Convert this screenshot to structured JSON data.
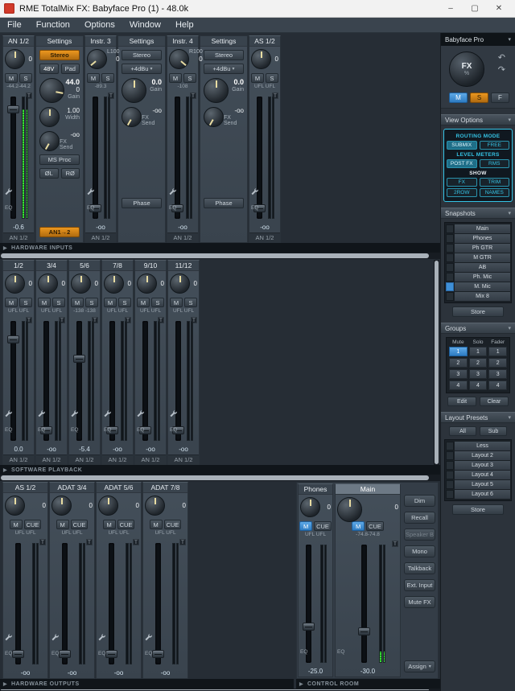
{
  "window": {
    "title": "RME TotalMix FX: Babyface Pro (1) - 48.0k",
    "minimize": "–",
    "maximize": "▢",
    "close": "✕"
  },
  "menu": {
    "items": [
      "File",
      "Function",
      "Options",
      "Window",
      "Help"
    ]
  },
  "common": {
    "mute": "M",
    "solo": "S",
    "cue": "CUE",
    "eq": "EQ",
    "trim": "T",
    "store": "Store"
  },
  "icons": {
    "chevron_down": "▾",
    "triangle_right": "▶",
    "undo": "↶",
    "redo": "↷"
  },
  "colors": {
    "accent_cyan": "#35c3e5",
    "accent_blue": "#3f8fd6",
    "accent_orange": "#c97c1f",
    "meter_green": "#38e038"
  },
  "hardware_inputs": {
    "section_label": "HARDWARE INPUTS",
    "channels": [
      {
        "name": "AN 1/2",
        "pan": "",
        "knob_value": "0",
        "level": "-44.2-44.2",
        "value": "-0.6",
        "target": "AN 1/2",
        "fader_pct": 7,
        "meter_pct": 90
      },
      {
        "name": "Instr. 3",
        "pan": "L100",
        "knob_value": "0",
        "level": "-89.3",
        "value": "-oo",
        "target": "AN 1/2",
        "fader_pct": 88,
        "meter_pct": 0
      },
      {
        "name": "Instr. 4",
        "pan": "R100",
        "knob_value": "0",
        "level": "-108",
        "value": "-oo",
        "target": "AN 1/2",
        "fader_pct": 88,
        "meter_pct": 0
      },
      {
        "name": "AS 1/2",
        "pan": "",
        "knob_value": "0",
        "level": "UFL UFL",
        "value": "-oo",
        "target": "AN 1/2",
        "fader_pct": 88,
        "meter_pct": 0
      }
    ],
    "settings_an": {
      "title": "Settings",
      "stereo": "Stereo",
      "phantom": "48V",
      "pad": "Pad",
      "gain_value": "44.0",
      "gain_value2": "0",
      "gain_label": "Gain",
      "width_value": "1.00",
      "width_label": "Width",
      "fx_value": "-oo",
      "fx_label": "FX Send",
      "ms_proc": "MS Proc",
      "phase_left": "ØL",
      "phase_right": "RØ",
      "route": "AN1→2"
    },
    "settings_instr": [
      {
        "title": "Settings",
        "stereo": "Stereo",
        "ref_level": "+4dBu",
        "gain_value": "0.0",
        "gain_label": "Gain",
        "fx_value": "-oo",
        "fx_label": "FX Send",
        "phase": "Phase"
      },
      {
        "title": "Settings",
        "stereo": "Stereo",
        "ref_level": "+4dBu",
        "gain_value": "0.0",
        "gain_label": "Gain",
        "fx_value": "-oo",
        "fx_label": "FX Send",
        "phase": "Phase"
      }
    ]
  },
  "software_playback": {
    "section_label": "SOFTWARE PLAYBACK",
    "channels": [
      {
        "name": "1/2",
        "knob_value": "0",
        "level": "UFL UFL",
        "value": "0.0",
        "target": "AN 1/2",
        "fader_pct": 12,
        "meter_pct": 0
      },
      {
        "name": "3/4",
        "knob_value": "0",
        "level": "UFL UFL",
        "value": "-oo",
        "target": "AN 1/2",
        "fader_pct": 88,
        "meter_pct": 0
      },
      {
        "name": "5/6",
        "knob_value": "0",
        "level": "-138 -138",
        "value": "-5.4",
        "target": "AN 1/2",
        "fader_pct": 28,
        "meter_pct": 0
      },
      {
        "name": "7/8",
        "knob_value": "0",
        "level": "UFL UFL",
        "value": "-oo",
        "target": "AN 1/2",
        "fader_pct": 88,
        "meter_pct": 0
      },
      {
        "name": "9/10",
        "knob_value": "0",
        "level": "UFL UFL",
        "value": "-oo",
        "target": "AN 1/2",
        "fader_pct": 88,
        "meter_pct": 0
      },
      {
        "name": "11/12",
        "knob_value": "0",
        "level": "UFL UFL",
        "value": "-oo",
        "target": "AN 1/2",
        "fader_pct": 88,
        "meter_pct": 0
      }
    ]
  },
  "hardware_outputs": {
    "section_label": "HARDWARE OUTPUTS",
    "channels": [
      {
        "name": "AS 1/2",
        "knob_value": "0",
        "level": "UFL UFL",
        "value": "-oo",
        "fader_pct": 88,
        "meter_pct": 0
      },
      {
        "name": "ADAT 3/4",
        "knob_value": "0",
        "level": "UFL UFL",
        "value": "-oo",
        "fader_pct": 88,
        "meter_pct": 0
      },
      {
        "name": "ADAT 5/6",
        "knob_value": "0",
        "level": "UFL UFL",
        "value": "-oo",
        "fader_pct": 88,
        "meter_pct": 0
      },
      {
        "name": "ADAT 7/8",
        "knob_value": "0",
        "level": "UFL UFL",
        "value": "-oo",
        "fader_pct": 88,
        "meter_pct": 0
      }
    ]
  },
  "control_room": {
    "section_label": "CONTROL ROOM",
    "phones": {
      "name": "Phones",
      "knob_value": "0",
      "level": "UFL UFL",
      "value": "-25.0",
      "fader_pct": 66,
      "meter_pct": 0
    },
    "main": {
      "name": "Main",
      "knob_value": "0",
      "level": "-74.8-74.8",
      "value": "-30.0",
      "fader_pct": 70,
      "meter_pct": 9
    },
    "buttons": [
      {
        "label": "Dim"
      },
      {
        "label": "Recall"
      },
      {
        "label": "Speaker B",
        "disabled": true
      },
      {
        "label": "Mono"
      },
      {
        "label": "Talkback"
      },
      {
        "label": "Ext. Input"
      },
      {
        "label": "Mute FX"
      }
    ],
    "assign": "Assign"
  },
  "sidebar": {
    "device": "Babyface Pro",
    "fx_label": "FX",
    "fx_unit": "%",
    "mode_buttons": [
      "M",
      "S",
      "F"
    ],
    "view_options": {
      "label": "View Options",
      "routing_mode_label": "ROUTING MODE",
      "submix": "SUBMIX",
      "free": "FREE",
      "level_meters_label": "LEVEL METERS",
      "post_fx": "POST FX",
      "rms": "RMS",
      "show_label": "SHOW",
      "fx": "FX",
      "trim": "TRIM",
      "row2": "2ROW",
      "names": "NAMES"
    },
    "snapshots": {
      "label": "Snapshots",
      "items": [
        {
          "name": "Main",
          "active": false
        },
        {
          "name": "Phones",
          "active": false
        },
        {
          "name": "Ph GTR",
          "active": false
        },
        {
          "name": "M GTR",
          "active": false
        },
        {
          "name": "AB",
          "active": false
        },
        {
          "name": "Ph. Mic",
          "active": false
        },
        {
          "name": "M. Mic",
          "active": true
        },
        {
          "name": "Mix 8",
          "active": false
        }
      ]
    },
    "groups": {
      "label": "Groups",
      "headers": [
        "Mute",
        "Solo",
        "Fader"
      ],
      "rows": [
        {
          "mute": "1",
          "solo": "1",
          "fader": "1",
          "mute_active": true
        },
        {
          "mute": "2",
          "solo": "2",
          "fader": "2"
        },
        {
          "mute": "3",
          "solo": "3",
          "fader": "3"
        },
        {
          "mute": "4",
          "solo": "4",
          "fader": "4"
        }
      ],
      "edit": "Edit",
      "clear": "Clear"
    },
    "layout_presets": {
      "label": "Layout Presets",
      "tabs": [
        "All",
        "Sub"
      ],
      "items": [
        {
          "name": "Less"
        },
        {
          "name": "Layout 2"
        },
        {
          "name": "Layout 3"
        },
        {
          "name": "Layout 4"
        },
        {
          "name": "Layout 5"
        },
        {
          "name": "Layout 6"
        }
      ]
    }
  }
}
